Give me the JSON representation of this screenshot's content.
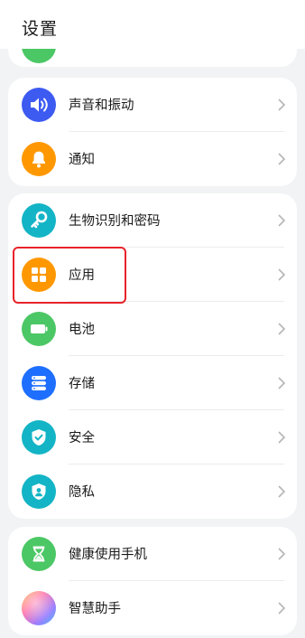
{
  "header": {
    "title": "设置"
  },
  "colors": {
    "sound": "#3d5af1",
    "notification": "#ff9800",
    "biometrics": "#13b4c5",
    "apps": "#ff9800",
    "battery": "#4cc765",
    "storage": "#1e6fff",
    "security": "#13b4c5",
    "privacy": "#13b4c5",
    "health": "#4cc765",
    "highlight": "#e8232b"
  },
  "groups": [
    {
      "items": [
        {
          "label": "声音和振动",
          "icon": "speaker-icon"
        },
        {
          "label": "通知",
          "icon": "bell-icon"
        }
      ]
    },
    {
      "items": [
        {
          "label": "生物识别和密码",
          "icon": "key-icon"
        },
        {
          "label": "应用",
          "icon": "apps-grid-icon"
        },
        {
          "label": "电池",
          "icon": "battery-icon"
        },
        {
          "label": "存储",
          "icon": "storage-icon"
        },
        {
          "label": "安全",
          "icon": "shield-check-icon"
        },
        {
          "label": "隐私",
          "icon": "privacy-shield-icon"
        }
      ]
    },
    {
      "items": [
        {
          "label": "健康使用手机",
          "icon": "hourglass-icon"
        },
        {
          "label": "智慧助手",
          "icon": "assistant-orb-icon"
        }
      ]
    }
  ]
}
